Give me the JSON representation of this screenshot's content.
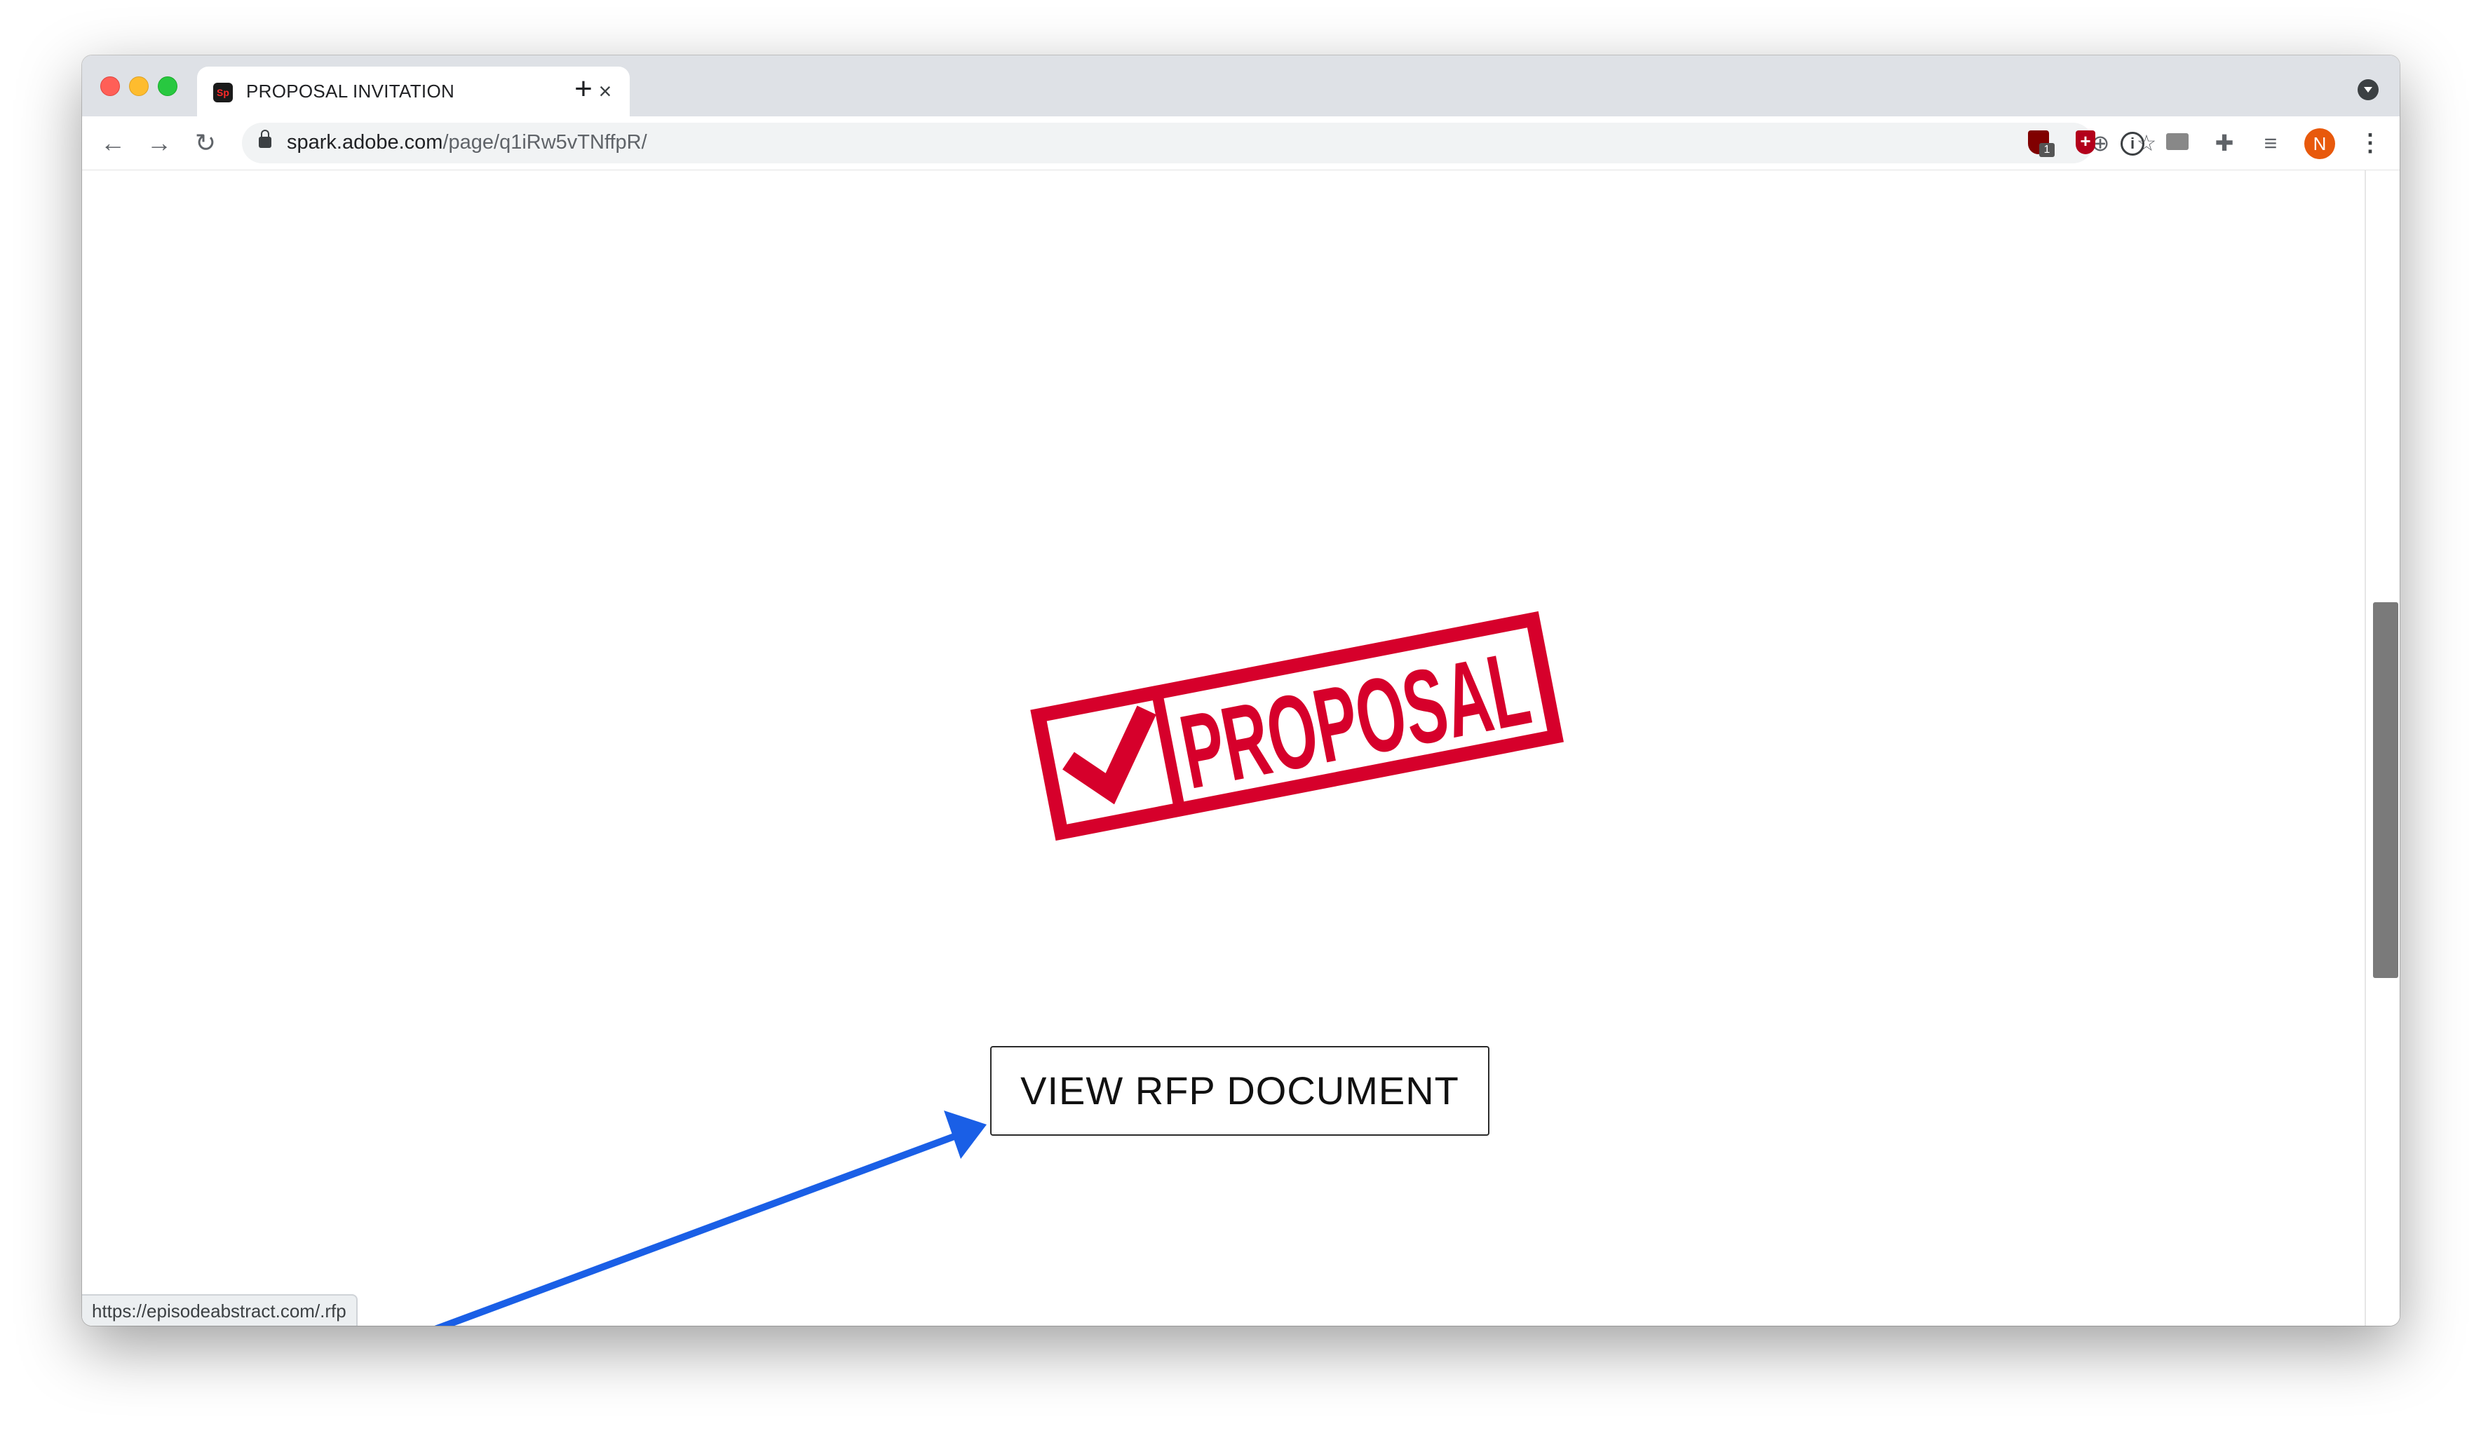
{
  "browser": {
    "tab_title": "PROPOSAL INVITATION",
    "tab_favicon_text": "Sp",
    "url_host": "spark.adobe.com",
    "url_path": "/page/q1iRw5vTNffpR/",
    "profile_initial": "N",
    "extension_badge": "1",
    "status_url": "https://episodeabstract.com/.rfp"
  },
  "page": {
    "stamp_text": "PROPOSAL",
    "button_label": "VIEW RFP DOCUMENT"
  },
  "colors": {
    "stamp_red": "#d6002b",
    "annotation_arrow": "#1a5fe6",
    "avatar_orange": "#e8590c"
  },
  "icons": {
    "back": "arrow-left-icon",
    "forward": "arrow-right-icon",
    "reload": "reload-icon",
    "lock": "lock-icon",
    "zoom": "zoom-icon",
    "bookmark": "star-icon",
    "extensions": [
      "ublock-icon",
      "shield-plus-icon",
      "info-icon",
      "doc-icon",
      "puzzle-icon",
      "media-icon"
    ],
    "menu": "kebab-menu-icon"
  }
}
